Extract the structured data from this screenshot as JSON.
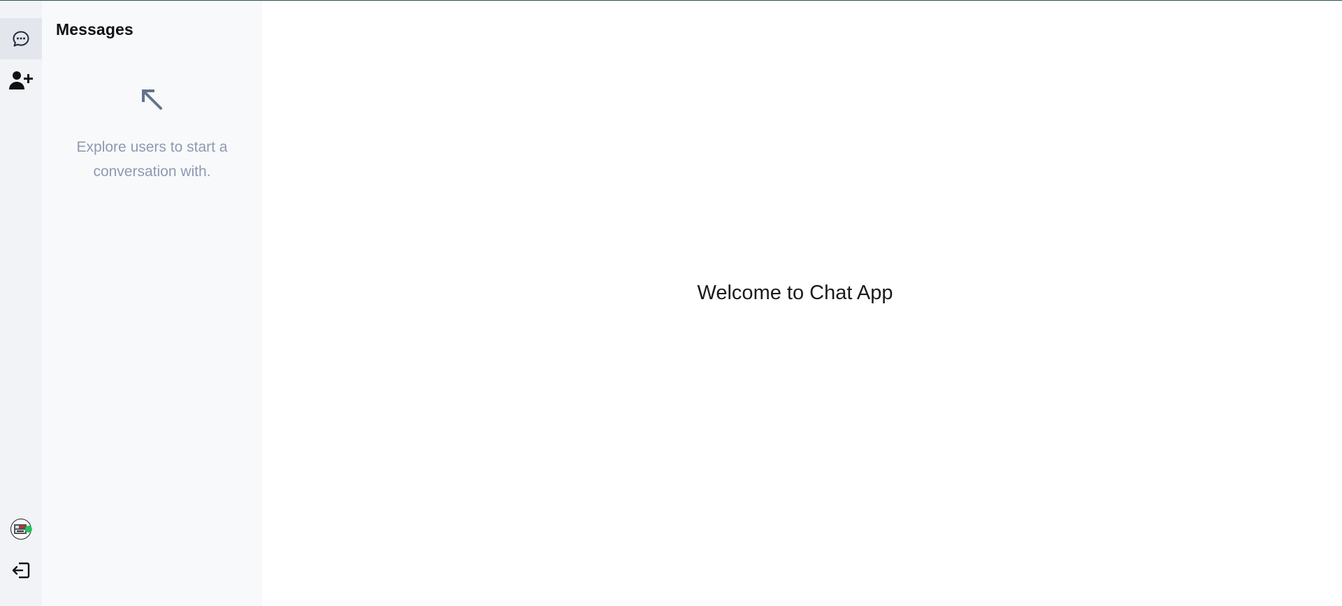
{
  "sidebar": {
    "nav": [
      {
        "label": "Messages",
        "icon": "chat-bubble-icon",
        "active": true
      },
      {
        "label": "Add contact",
        "icon": "user-plus-icon",
        "active": false
      }
    ],
    "user": {
      "status": "online",
      "status_color": "#22c55e"
    },
    "logout_icon": "logout-icon"
  },
  "panel": {
    "title": "Messages",
    "empty_icon": "arrow-up-left-icon",
    "empty_text": "Explore users to start a conversation with."
  },
  "main": {
    "welcome": "Welcome to Chat App"
  },
  "colors": {
    "rail_bg": "#f1f3f7",
    "panel_bg": "#f8f9fb",
    "muted_text": "#8e9ab0",
    "arrow": "#64748b"
  }
}
